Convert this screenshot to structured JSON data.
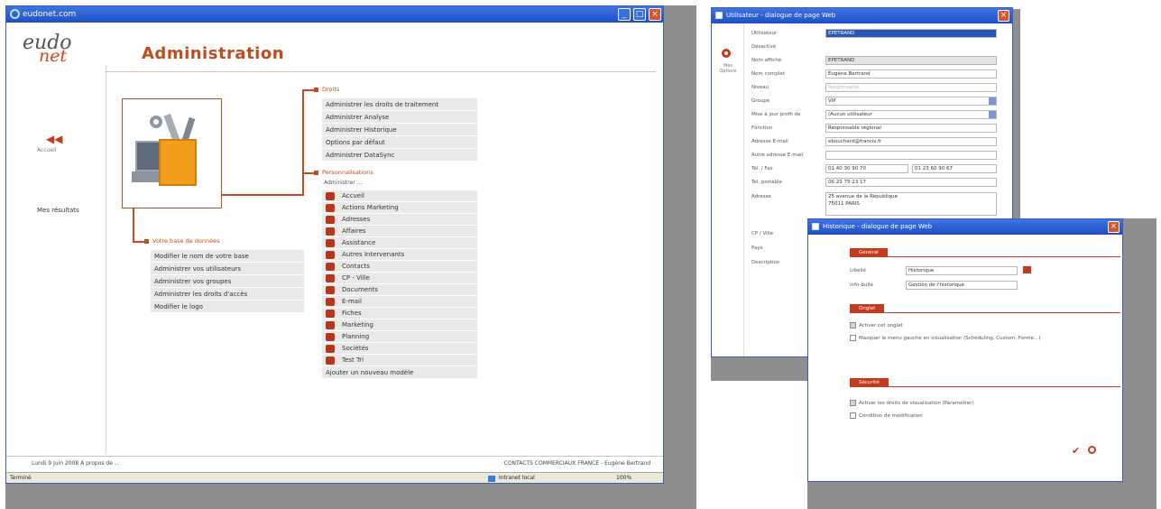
{
  "main_window": {
    "title": "eudonet.com",
    "logo": {
      "line1": "eudo",
      "line2": "net"
    },
    "page_title": "Administration",
    "sidebar": {
      "back_label": "Accueil",
      "link": "Mes résultats"
    },
    "sections": {
      "droits": {
        "title": "Droits",
        "items": [
          "Administrer les droits de traitement",
          "Administrer Analyse",
          "Administrer Historique",
          "Options par défaut",
          "Administrer DataSync"
        ]
      },
      "personnalisations": {
        "title": "Personnalisations",
        "subtitle": "Administrer ...",
        "items": [
          "Accueil",
          "Actions Marketing",
          "Adresses",
          "Affaires",
          "Assistance",
          "Autres Intervenants",
          "Contacts",
          "CP - Ville",
          "Documents",
          "E-mail",
          "Fiches",
          "Marketing",
          "Planning",
          "Sociétés",
          "Test Tri"
        ],
        "add_new": "Ajouter un nouveau modèle"
      },
      "base": {
        "title": "Votre base de données",
        "items": [
          "Modifier le nom de votre base",
          "Administrer vos utilisateurs",
          "Administrer vos groupes",
          "Administrer les droits d'accès",
          "Modifier le logo"
        ]
      }
    },
    "footer": {
      "left": "Lundi 9 Juin 2008   A propos de ...",
      "right": "CONTACTS COMMERCIAUX FRANCE - Eugène Bertrand"
    },
    "statusbar": {
      "left": "Terminé",
      "zone": "Intranet local",
      "zoom": "100%"
    }
  },
  "user_dialog": {
    "title": "Utilisateur  -  dialogue de page Web",
    "side_label": "Mes Options",
    "fields": [
      {
        "label": "Utilisateur",
        "value": "EPETRAND"
      },
      {
        "label": "Désactivé",
        "value": ""
      },
      {
        "label": "Nom affiché",
        "value": "EPETRAND"
      },
      {
        "label": "Nom complet",
        "value": "Eugène Bertrand"
      },
      {
        "label": "Niveau",
        "value": "Responsable"
      },
      {
        "label": "Groupe",
        "value": "VIP"
      },
      {
        "label": "Mise à jour profil de",
        "value": "(Aucun utilisateur"
      },
      {
        "label": "Fonction",
        "value": "Responsable régional"
      },
      {
        "label": "Adresse E-mail",
        "value": "ebouchard@francis.fr"
      },
      {
        "label": "Autre adresse E-mail",
        "value": ""
      },
      {
        "label": "Tél. / Fax",
        "value": "01 40 30 90 70"
      },
      {
        "label": "Tél. portable",
        "value": "06 23 75 23 17"
      },
      {
        "label": "Adresse",
        "value": "25 avenue de la République"
      }
    ],
    "fax_value": "01 23 60 90 67",
    "address_line2": "75011 PARIS",
    "extra_labels": [
      "CP / Ville",
      "Pays",
      "Description"
    ]
  },
  "history_dialog": {
    "title": "Historique  -  dialogue de page Web",
    "general_tab": "Général",
    "fields": [
      {
        "label": "Libellé",
        "value": "Historique"
      },
      {
        "label": "Info-bulle",
        "value": "Gestion de l'historique"
      }
    ],
    "onglet_tab": "Onglet",
    "onglet_checks": [
      {
        "label": "Activer cet onglet",
        "checked": true
      },
      {
        "label": "Masquer le menu gauche en visualisation (Scheduling, Custom, Forme...)",
        "checked": false
      }
    ],
    "security_tab": "Sécurité",
    "security_checks": [
      {
        "label": "Activer les droits de visualisation (Paramétrer)",
        "checked": true
      },
      {
        "label": "Condition de modification",
        "checked": false
      }
    ]
  },
  "colors": {
    "accent": "#c7391c",
    "titlebar": "#2a5bd6",
    "shadow": "#8e8e8e"
  }
}
